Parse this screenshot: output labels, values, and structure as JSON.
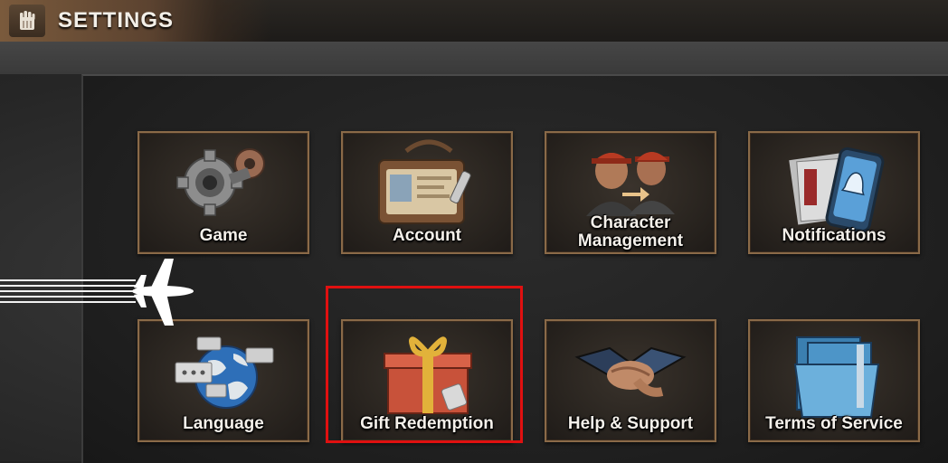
{
  "header": {
    "title": "SETTINGS",
    "icon": "fist-emblem-icon"
  },
  "tiles": [
    {
      "label": "Game",
      "icon": "gears-icon"
    },
    {
      "label": "Account",
      "icon": "id-card-icon"
    },
    {
      "label": "Character\nManagement",
      "icon": "character-swap-icon"
    },
    {
      "label": "Notifications",
      "icon": "phone-bell-icon"
    },
    {
      "label": "Language",
      "icon": "globe-chat-icon"
    },
    {
      "label": "Gift Redemption",
      "icon": "gift-box-icon"
    },
    {
      "label": "Help & Support",
      "icon": "handshake-icon"
    },
    {
      "label": "Terms of Service",
      "icon": "folder-icon"
    }
  ],
  "colors": {
    "highlight": "#e01010",
    "tile_border": "#8a6a48"
  }
}
